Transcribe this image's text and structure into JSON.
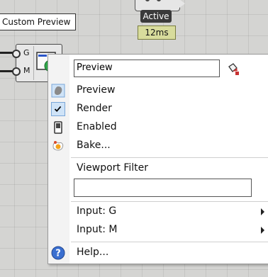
{
  "canvas": {
    "active_component": {
      "status": "Active",
      "timing": "12ms"
    },
    "tooltip": "Custom Preview",
    "preview_component": {
      "inputs": [
        "G",
        "M"
      ]
    }
  },
  "menu": {
    "name_value": "Preview",
    "items": {
      "preview": {
        "label": "Preview",
        "icon": "preview-icon",
        "checked": false
      },
      "render": {
        "label": "Render",
        "icon": "checkmark-icon",
        "checked": true
      },
      "enabled": {
        "label": "Enabled",
        "icon": "enabled-switch-icon"
      },
      "bake": {
        "label": "Bake...",
        "icon": "bake-egg-icon"
      }
    },
    "viewport_filter": {
      "label": "Viewport Filter",
      "value": ""
    },
    "inputs": [
      {
        "label": "Input: G"
      },
      {
        "label": "Input: M"
      }
    ],
    "help": {
      "label": "Help...",
      "icon": "help-icon"
    }
  },
  "colors": {
    "canvas_bg": "#d4d4d2",
    "active_badge": "#3a3a3a",
    "timing_badge": "#d8dc9c",
    "check_highlight": "#cfe3f7",
    "help_blue": "#3a6fd0"
  }
}
